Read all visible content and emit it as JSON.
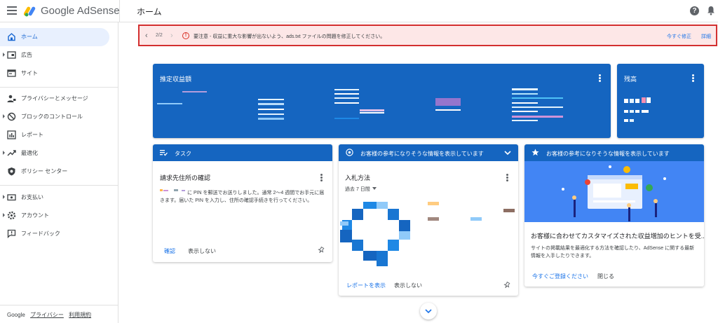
{
  "header": {
    "brand": "Google AdSense",
    "page_title": "ホーム",
    "help_glyph": "?"
  },
  "sidebar": {
    "items": [
      {
        "label": "ホーム",
        "icon": "home-icon",
        "active": true
      },
      {
        "label": "広告",
        "icon": "ads-icon"
      },
      {
        "label": "サイト",
        "icon": "sites-icon"
      },
      {
        "label": "プライバシーとメッセージ",
        "icon": "privacy-icon"
      },
      {
        "label": "ブロックのコントロール",
        "icon": "block-icon"
      },
      {
        "label": "レポート",
        "icon": "reports-icon"
      },
      {
        "label": "最適化",
        "icon": "optimization-icon"
      },
      {
        "label": "ポリシー センター",
        "icon": "policy-icon"
      },
      {
        "label": "お支払い",
        "icon": "payments-icon"
      },
      {
        "label": "アカウント",
        "icon": "account-icon"
      },
      {
        "label": "フィードバック",
        "icon": "feedback-icon"
      }
    ],
    "footer": {
      "brand": "Google",
      "privacy": "プライバシー",
      "terms": "利用規約"
    }
  },
  "alert": {
    "pager": "2/2",
    "message": "要注意 - 収益に重大な影響が出ないよう、ads.txt ファイルの問題を修正してください。",
    "fix_label": "今すぐ修正",
    "detail_label": "詳細",
    "warn_glyph": "!",
    "prev_glyph": "‹",
    "next_glyph": "›"
  },
  "earnings_card": {
    "title": "推定収益額"
  },
  "balance_card": {
    "title": "残高"
  },
  "task_card": {
    "header": "タスク",
    "subtitle": "請求先住所の確認",
    "body": "に PIN を郵送でお送りしました。通常 2～4 週間でお手元に届きます。届いた PIN を入力し、住所の確認手続きを行ってください。",
    "confirm_label": "確認",
    "hide_label": "表示しない"
  },
  "bidding_card": {
    "header": "お客様の参考になりそうな情報を表示しています",
    "subtitle": "入札方法",
    "period": "過去 7 日間",
    "report_label": "レポートを表示",
    "hide_label": "表示しない"
  },
  "tips_card": {
    "header": "お客様の参考になりそうな情報を表示しています",
    "title": "お客様に合わせてカスタマイズされた収益増加のヒントを受...",
    "body": "サイトの掲載結果を最適化する方法を確認したり、AdSense に関する最新情報を入手したりできます。",
    "register_label": "今すぐご登録ください",
    "close_label": "閉じる"
  },
  "colors": {
    "primary_blue": "#1565c0",
    "link_blue": "#1a73e8",
    "alert_red": "#d32f2f"
  }
}
